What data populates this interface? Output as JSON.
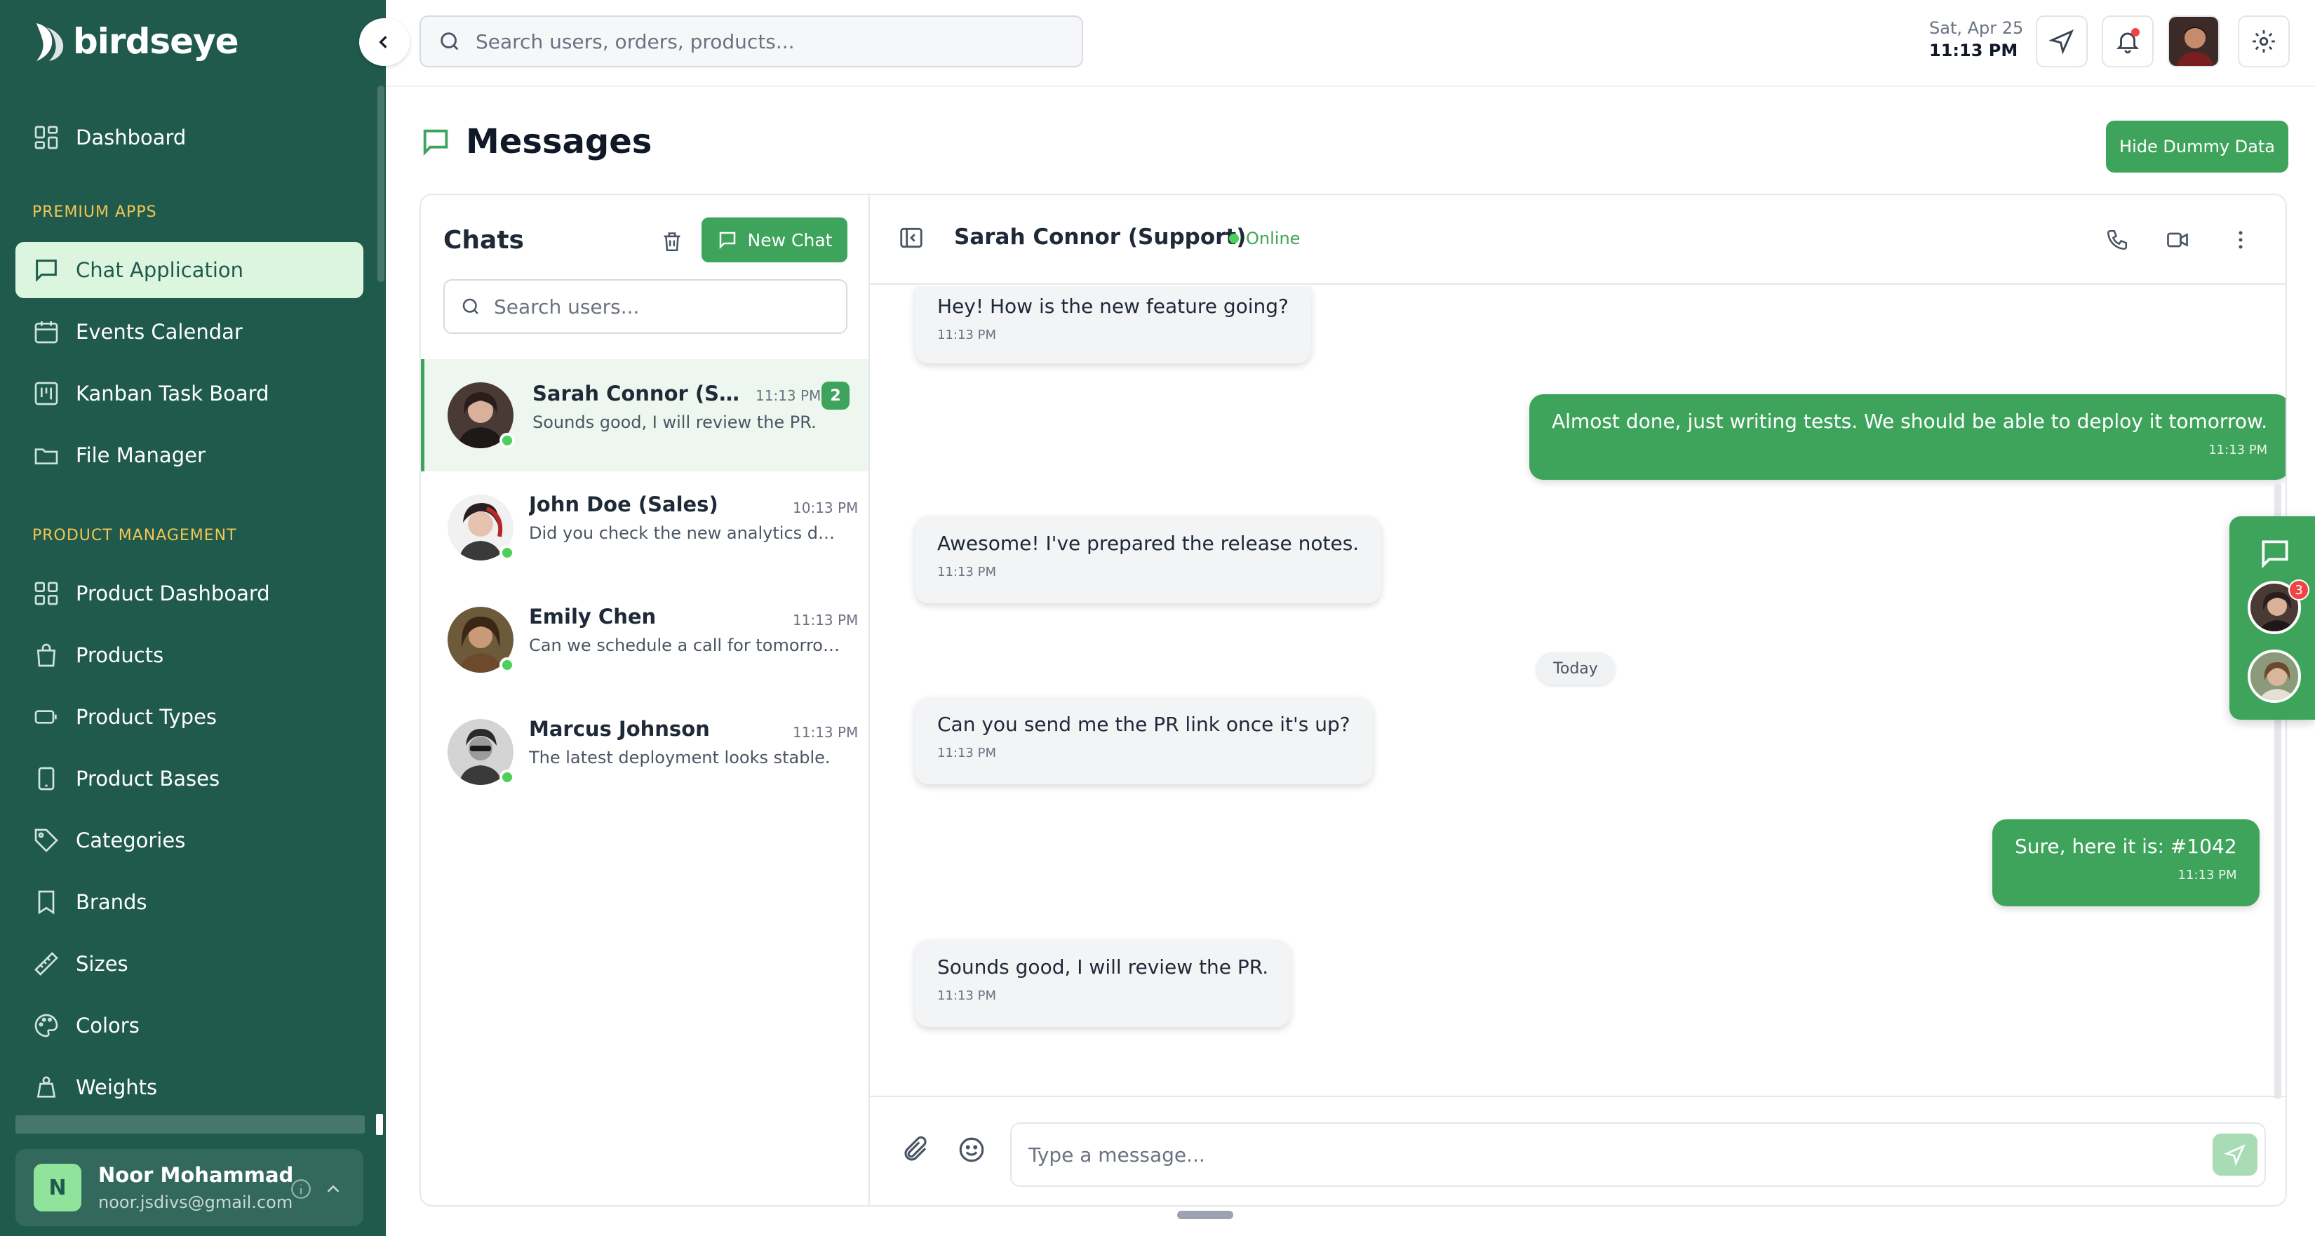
{
  "app": {
    "name": "birdseye"
  },
  "sidebar": {
    "sections": [
      {
        "label": ""
      },
      {
        "label": "PREMIUM APPS"
      },
      {
        "label": "PRODUCT MANAGEMENT"
      }
    ],
    "items": [
      {
        "label": "Dashboard",
        "icon": "grid-icon"
      },
      {
        "label": "Chat Application",
        "icon": "chat-icon",
        "active": true
      },
      {
        "label": "Events Calendar",
        "icon": "calendar-icon"
      },
      {
        "label": "Kanban Task Board",
        "icon": "kanban-icon"
      },
      {
        "label": "File Manager",
        "icon": "folder-icon"
      },
      {
        "label": "Product Dashboard",
        "icon": "grid-icon"
      },
      {
        "label": "Products",
        "icon": "bag-icon"
      },
      {
        "label": "Product Types",
        "icon": "type-icon"
      },
      {
        "label": "Product Bases",
        "icon": "device-icon"
      },
      {
        "label": "Categories",
        "icon": "tag-icon"
      },
      {
        "label": "Brands",
        "icon": "bookmark-icon"
      },
      {
        "label": "Sizes",
        "icon": "ruler-icon"
      },
      {
        "label": "Colors",
        "icon": "palette-icon"
      },
      {
        "label": "Weights",
        "icon": "weight-icon"
      }
    ],
    "user": {
      "initial": "N",
      "name": "Noor Mohammad",
      "email": "noor.jsdivs@gmail.com"
    }
  },
  "topbar": {
    "search_placeholder": "Search users, orders, products...",
    "date": "Sat, Apr 25",
    "time": "11:13 PM"
  },
  "page": {
    "title": "Messages",
    "hide_button": "Hide Dummy Data"
  },
  "chats": {
    "title": "Chats",
    "new_chat": "New Chat",
    "search_placeholder": "Search users...",
    "conversations": [
      {
        "name": "Sarah Connor (Support)",
        "time": "11:13 PM",
        "preview": "Sounds good, I will review the PR.",
        "unread": "2",
        "online": true
      },
      {
        "name": "John Doe (Sales)",
        "time": "10:13 PM",
        "preview": "Did you check the new analytics dashboard?",
        "online": true
      },
      {
        "name": "Emily Chen",
        "time": "11:13 PM",
        "preview": "Can we schedule a call for tomorrow?",
        "online": true
      },
      {
        "name": "Marcus Johnson",
        "time": "11:13 PM",
        "preview": "The latest deployment looks stable.",
        "online": true
      }
    ]
  },
  "conversation": {
    "name": "Sarah Connor (Support)",
    "status": "Online",
    "separator": "Today",
    "messages": [
      {
        "direction": "in",
        "text": "Hey! How is the new feature going?",
        "time": "11:13 PM"
      },
      {
        "direction": "out",
        "text": "Almost done, just writing tests. We should be able to deploy it tomorrow.",
        "time": "11:13 PM"
      },
      {
        "direction": "in",
        "text": "Awesome! I've prepared the release notes.",
        "time": "11:13 PM"
      },
      {
        "direction": "in",
        "text": "Can you send me the PR link once it's up?",
        "time": "11:13 PM"
      },
      {
        "direction": "out",
        "text": "Sure, here it is: #1042",
        "time": "11:13 PM"
      },
      {
        "direction": "in",
        "text": "Sounds good, I will review the PR.",
        "time": "11:13 PM"
      }
    ],
    "composer_placeholder": "Type a message..."
  },
  "float_dock": {
    "badge": "3"
  },
  "colors": {
    "sidebar": "#1f5a4c",
    "accent": "#3fa45b",
    "section": "#f3c653",
    "online": "#4ccf5b"
  }
}
